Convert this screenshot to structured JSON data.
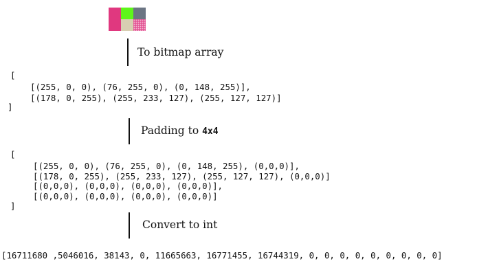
{
  "image": {
    "pixels": [
      {
        "color": "#e0387f",
        "pattern": "solid"
      },
      {
        "color": "#5ef51a",
        "pattern": "solid"
      },
      {
        "color": "#6b7583",
        "pattern": "solid"
      },
      {
        "color": "#e0387f",
        "pattern": "solid"
      },
      {
        "color": "#d8cfb2",
        "pattern": "solid"
      },
      {
        "color": "#e45896",
        "pattern": "dither"
      }
    ]
  },
  "steps": {
    "bitmap_label": "To bitmap array",
    "padding_label_prefix": "Padding to ",
    "padding_size": "4x4",
    "convert_label": "Convert to int"
  },
  "bitmap_array": {
    "open": "[",
    "rows": [
      "[(255, 0, 0), (76, 255, 0), (0, 148, 255)],",
      "[(178, 0, 255), (255, 233, 127), (255, 127, 127)]"
    ],
    "close": "]"
  },
  "padded_array": {
    "open": "[",
    "rows": [
      "[(255, 0, 0), (76, 255, 0), (0, 148, 255), (0,0,0)],",
      "[(178, 0, 255), (255, 233, 127), (255, 127, 127), (0,0,0)]",
      "[(0,0,0), (0,0,0), (0,0,0), (0,0,0)],",
      "[(0,0,0), (0,0,0), (0,0,0), (0,0,0)]"
    ],
    "close": "]"
  },
  "result": "[16711680 ,5046016, 38143, 0, 11665663, 16771455, 16744319, 0, 0, 0, 0, 0, 0, 0, 0, 0]"
}
